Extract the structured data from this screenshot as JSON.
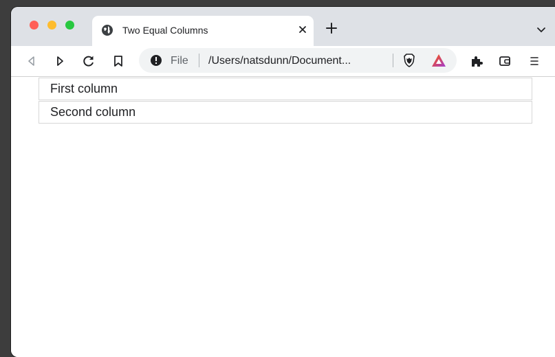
{
  "tab": {
    "title": "Two Equal Columns"
  },
  "omnibox": {
    "scheme": "File",
    "url": "/Users/natsdunn/Document..."
  },
  "page": {
    "columns": [
      "First column",
      "Second column"
    ]
  },
  "colors": {
    "tabstrip": "#dee1e6",
    "red": "#ff5f57",
    "yellow": "#febc2e",
    "green": "#28c840"
  }
}
